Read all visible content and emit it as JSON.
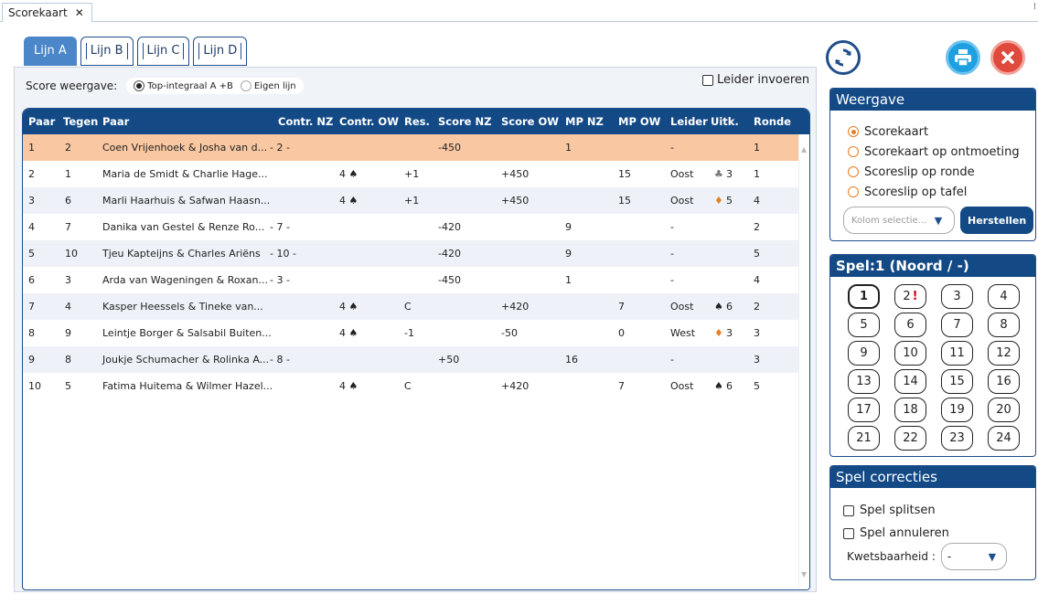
{
  "window": {
    "tab_title": "Scorekaart",
    "tab_close": "✕",
    "menu_dots": "⁝"
  },
  "lines": [
    {
      "label": "Lijn A",
      "active": true
    },
    {
      "label": "Lijn B",
      "active": false
    },
    {
      "label": "Lijn C",
      "active": false
    },
    {
      "label": "Lijn D",
      "active": false
    }
  ],
  "score_view": {
    "label": "Score weergave:",
    "options": [
      {
        "label": "Top-integraal A +B",
        "selected": true
      },
      {
        "label": "Eigen lijn",
        "selected": false
      }
    ]
  },
  "leader_checkbox": {
    "label": "Leider invoeren",
    "checked": false
  },
  "table": {
    "headers": [
      "Paar",
      "Tegen",
      "Paar",
      "Contr. NZ",
      "Contr. OW",
      "Res.",
      "Score NZ",
      "Score OW",
      "MP NZ",
      "MP OW",
      "Leider",
      "Uitk.",
      "Ronde"
    ],
    "rows": [
      {
        "paar": "1",
        "tegen": "2",
        "names": "Coen Vrijenhoek & Josha van d...",
        "contr_nz": "- 2 -",
        "contr_ow": "",
        "res": "",
        "score_nz": "-450",
        "score_ow": "",
        "mp_nz": "1",
        "mp_ow": "",
        "leider": "-",
        "uitk_suit": "",
        "uitk_num": "",
        "ronde": "1"
      },
      {
        "paar": "2",
        "tegen": "1",
        "names": "Maria de Smidt & Charlie Hage...",
        "contr_nz": "",
        "contr_ow": "4 ♠",
        "res": "+1",
        "score_nz": "",
        "score_ow": "+450",
        "mp_nz": "",
        "mp_ow": "15",
        "leider": "Oost",
        "uitk_suit": "♣",
        "uitk_num": "3",
        "ronde": "1"
      },
      {
        "paar": "3",
        "tegen": "6",
        "names": "Marli Haarhuis & Safwan Haasn...",
        "contr_nz": "",
        "contr_ow": "4 ♠",
        "res": "+1",
        "score_nz": "",
        "score_ow": "+450",
        "mp_nz": "",
        "mp_ow": "15",
        "leider": "Oost",
        "uitk_suit": "♦",
        "uitk_num": "5",
        "ronde": "4"
      },
      {
        "paar": "4",
        "tegen": "7",
        "names": "Danika van Gestel & Renze Ro...",
        "contr_nz": "- 7 -",
        "contr_ow": "",
        "res": "",
        "score_nz": "-420",
        "score_ow": "",
        "mp_nz": "9",
        "mp_ow": "",
        "leider": "-",
        "uitk_suit": "",
        "uitk_num": "",
        "ronde": "2"
      },
      {
        "paar": "5",
        "tegen": "10",
        "names": "Tjeu Kapteijns & Charles Ariëns",
        "contr_nz": "- 10 -",
        "contr_ow": "",
        "res": "",
        "score_nz": "-420",
        "score_ow": "",
        "mp_nz": "9",
        "mp_ow": "",
        "leider": "-",
        "uitk_suit": "",
        "uitk_num": "",
        "ronde": "5"
      },
      {
        "paar": "6",
        "tegen": "3",
        "names": "Arda van Wageningen & Roxan...",
        "contr_nz": "- 3 -",
        "contr_ow": "",
        "res": "",
        "score_nz": "-450",
        "score_ow": "",
        "mp_nz": "1",
        "mp_ow": "",
        "leider": "-",
        "uitk_suit": "",
        "uitk_num": "",
        "ronde": "4"
      },
      {
        "paar": "7",
        "tegen": "4",
        "names": "Kasper Heessels & Tineke van...",
        "contr_nz": "",
        "contr_ow": "4 ♠",
        "res": "C",
        "score_nz": "",
        "score_ow": "+420",
        "mp_nz": "",
        "mp_ow": "7",
        "leider": "Oost",
        "uitk_suit": "♠",
        "uitk_num": "6",
        "ronde": "2"
      },
      {
        "paar": "8",
        "tegen": "9",
        "names": "Leintje Borger & Salsabil Buiten...",
        "contr_nz": "",
        "contr_ow": "4 ♠",
        "res": "-1",
        "score_nz": "",
        "score_ow": "-50",
        "mp_nz": "",
        "mp_ow": "0",
        "leider": "West",
        "uitk_suit": "♦",
        "uitk_num": "3",
        "ronde": "3"
      },
      {
        "paar": "9",
        "tegen": "8",
        "names": "Joukje Schumacher & Rolinka A...",
        "contr_nz": "- 8 -",
        "contr_ow": "",
        "res": "",
        "score_nz": "+50",
        "score_ow": "",
        "mp_nz": "16",
        "mp_ow": "",
        "leider": "-",
        "uitk_suit": "",
        "uitk_num": "",
        "ronde": "3"
      },
      {
        "paar": "10",
        "tegen": "5",
        "names": "Fatima Huitema & Wilmer Hazel...",
        "contr_nz": "",
        "contr_ow": "4 ♠",
        "res": "C",
        "score_nz": "",
        "score_ow": "+420",
        "mp_nz": "",
        "mp_ow": "7",
        "leider": "Oost",
        "uitk_suit": "♠",
        "uitk_num": "6",
        "ronde": "5"
      }
    ]
  },
  "weergave": {
    "title": "Weergave",
    "options": [
      {
        "label": "Scorekaart",
        "selected": true
      },
      {
        "label": "Scorekaart op ontmoeting",
        "selected": false
      },
      {
        "label": "Scoreslip op ronde",
        "selected": false
      },
      {
        "label": "Scoreslip op tafel",
        "selected": false
      }
    ],
    "select_placeholder": "Kolom selectie...",
    "reset_button": "Herstellen"
  },
  "spel": {
    "title": "Spel:1 (Noord / -)",
    "boards": [
      "1",
      "2",
      "3",
      "4",
      "5",
      "6",
      "7",
      "8",
      "9",
      "10",
      "11",
      "12",
      "13",
      "14",
      "15",
      "16",
      "17",
      "18",
      "19",
      "20",
      "21",
      "22",
      "23",
      "24"
    ],
    "active_board": "1",
    "warning_board": "2",
    "warning_mark": "!"
  },
  "corrections": {
    "title": "Spel correcties",
    "options": [
      {
        "label": "Spel splitsen",
        "checked": false
      },
      {
        "label": "Spel annuleren",
        "checked": false
      }
    ],
    "kwets_label": "Kwetsbaarheid :",
    "kwets_value": "-"
  }
}
